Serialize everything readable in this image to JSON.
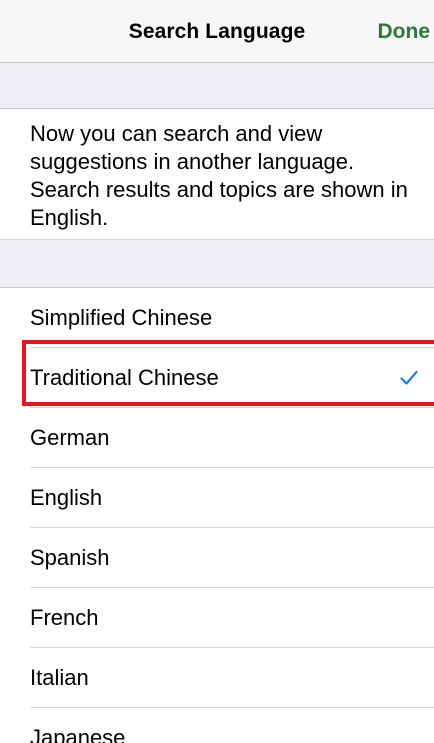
{
  "header": {
    "title": "Search Language",
    "done_label": "Done"
  },
  "description": "Now you can search and view suggestions in another language. Search results and topics are shown in English.",
  "languages": [
    {
      "label": "Simplified Chinese",
      "selected": false
    },
    {
      "label": "Traditional Chinese",
      "selected": true
    },
    {
      "label": "German",
      "selected": false
    },
    {
      "label": "English",
      "selected": false
    },
    {
      "label": "Spanish",
      "selected": false
    },
    {
      "label": "French",
      "selected": false
    },
    {
      "label": "Italian",
      "selected": false
    },
    {
      "label": "Japanese",
      "selected": false
    }
  ],
  "colors": {
    "accent_done": "#2a7a36",
    "checkmark": "#1a7cf5",
    "highlight_box": "#e8141c",
    "group_background": "#efeff4"
  },
  "icons": {
    "selected_marker": "checkmark-icon"
  }
}
